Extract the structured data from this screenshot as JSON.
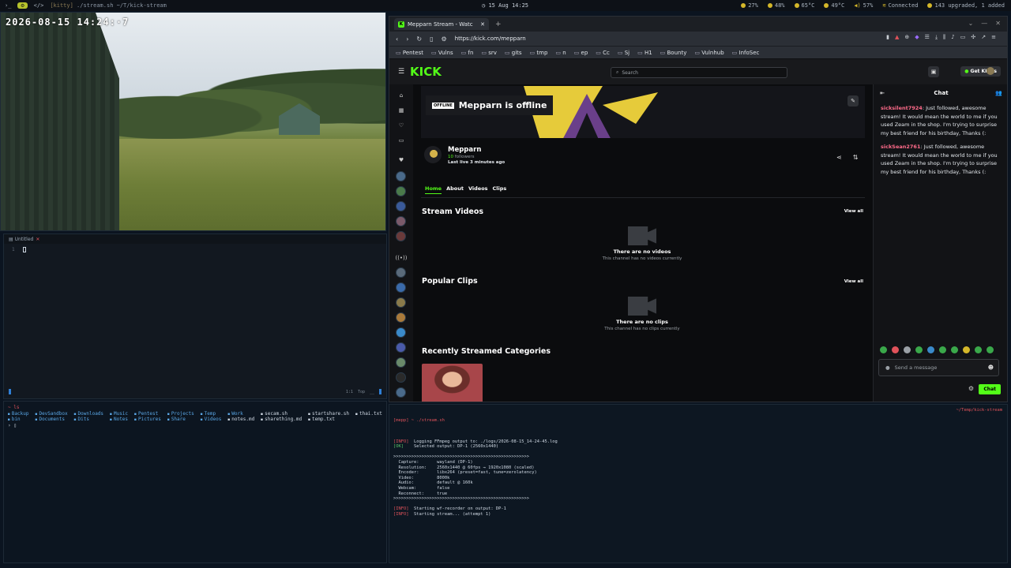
{
  "topbar": {
    "workspace_prev": "›_",
    "workspace_active": "⚙",
    "workspace_next": "</>",
    "window_app": "[kitty]",
    "window_cmd": "./stream.sh ~/T/kick-stream",
    "clock": "15 Aug 14:25",
    "cpu": "27%",
    "mem": "48%",
    "temp1": "65°C",
    "temp2": "49°C",
    "volume": "57%",
    "network": "Connected",
    "updates": "143 upgraded, 1 added"
  },
  "camera": {
    "timestamp": "2026-08-15 14:24:·7"
  },
  "editor": {
    "tab_label": "Untitled",
    "line_number": "1",
    "position": "1:1",
    "scroll": "Top"
  },
  "files": {
    "prompt": "~ ls",
    "row1": [
      "Backup",
      "DevSandbox",
      "Downloads",
      "Music",
      "Pentest",
      "Projects",
      "Temp",
      "Work",
      "secam.sh",
      "startshare.sh",
      "thai.txt"
    ],
    "row2": [
      "bin",
      "Documents",
      "Dits",
      "Notes",
      "Pictures",
      "Share",
      "Videos",
      "notes.md",
      "sharething.md",
      "temp.txt"
    ],
    "cursor": "› ▯"
  },
  "browser": {
    "tab_title": "Mepparn Stream - Watc",
    "url": "https://kick.com/mepparn",
    "bookmarks": [
      "Pentest",
      "Vulns",
      "fn",
      "srv",
      "gits",
      "tmp",
      "n",
      "ep",
      "Cc",
      "Sj",
      "H1",
      "Bounty",
      "Vulnhub",
      "InfoSec"
    ]
  },
  "kick": {
    "logo": "KICK",
    "search_placeholder": "Search",
    "get_kicks": "Get KICKs",
    "offline_badge": "OFFLINE",
    "offline_text": "Mepparn is offline",
    "channel_name": "Mepparn",
    "followers_count": "10",
    "followers_label": "followers",
    "last_live": "Last live 3 minutes ago",
    "tabs": [
      "Home",
      "About",
      "Videos",
      "Clips"
    ],
    "stream_videos_title": "Stream Videos",
    "view_all": "View all",
    "no_videos": "There are no videos",
    "no_videos_sub": "This channel has no videos currently",
    "popular_clips_title": "Popular Clips",
    "no_clips": "There are no clips",
    "no_clips_sub": "This channel has no clips currently",
    "categories_title": "Recently Streamed Categories",
    "chat": {
      "title": "Chat",
      "messages": [
        {
          "user": "sicksilent7924",
          "text": ": Just followed, awesome stream! It would mean the world to me if you used Zeam in the shop. I'm trying to surprise my best friend for his birthday, Thanks (:"
        },
        {
          "user": "sickSean2761",
          "text": ": Just followed, awesome stream! It would mean the world to me if you used Zeam in the shop. I'm trying to surprise my best friend for his birthday, Thanks (:"
        }
      ],
      "input_placeholder": "Send a message",
      "send": "Chat"
    }
  },
  "stream_term": {
    "prompt": "[mepp] ~ ./stream.sh",
    "path": "~/Temp/kick-stream",
    "lines": [
      {
        "tag": "[INFO]",
        "cls": "red",
        "text": "  Logging FFmpeg output to: ./logs/2026-08-15_14-24-45.log"
      },
      {
        "tag": "[OK]",
        "cls": "green",
        "text": "    Selected output: DP-1 (2560x1440)"
      },
      {
        "tag": "",
        "cls": "",
        "text": ""
      },
      {
        "tag": "",
        "cls": "",
        "text": ">>>>>>>>>>>>>>>>>>>>>>>>>>>>>>>>>>>>>>>>>>>>>>>>>>>>>"
      },
      {
        "tag": "",
        "cls": "",
        "text": "  Capture:       wayland (DP-1)"
      },
      {
        "tag": "",
        "cls": "",
        "text": "  Resolution:    2560x1440 @ 60fps → 1920x1080 (scaled)"
      },
      {
        "tag": "",
        "cls": "",
        "text": "  Encoder:       libx264 (preset=fast, tune=zerolatency)"
      },
      {
        "tag": "",
        "cls": "",
        "text": "  Video:         8000k"
      },
      {
        "tag": "",
        "cls": "",
        "text": "  Audio:         default @ 160k"
      },
      {
        "tag": "",
        "cls": "",
        "text": "  Webcam:        false"
      },
      {
        "tag": "",
        "cls": "",
        "text": "  Reconnect:     true"
      },
      {
        "tag": "",
        "cls": "",
        "text": ">>>>>>>>>>>>>>>>>>>>>>>>>>>>>>>>>>>>>>>>>>>>>>>>>>>>>"
      },
      {
        "tag": "",
        "cls": "",
        "text": ""
      },
      {
        "tag": "[INFO]",
        "cls": "red",
        "text": "  Starting wf-recorder on output: DP-1"
      },
      {
        "tag": "[INFO]",
        "cls": "red",
        "text": "  Starting stream... (attempt 1)"
      }
    ]
  },
  "colors": {
    "kick_green": "#53fc18",
    "chat_user": "#ff6b8a",
    "accent_workspace": "#b5c22c"
  }
}
